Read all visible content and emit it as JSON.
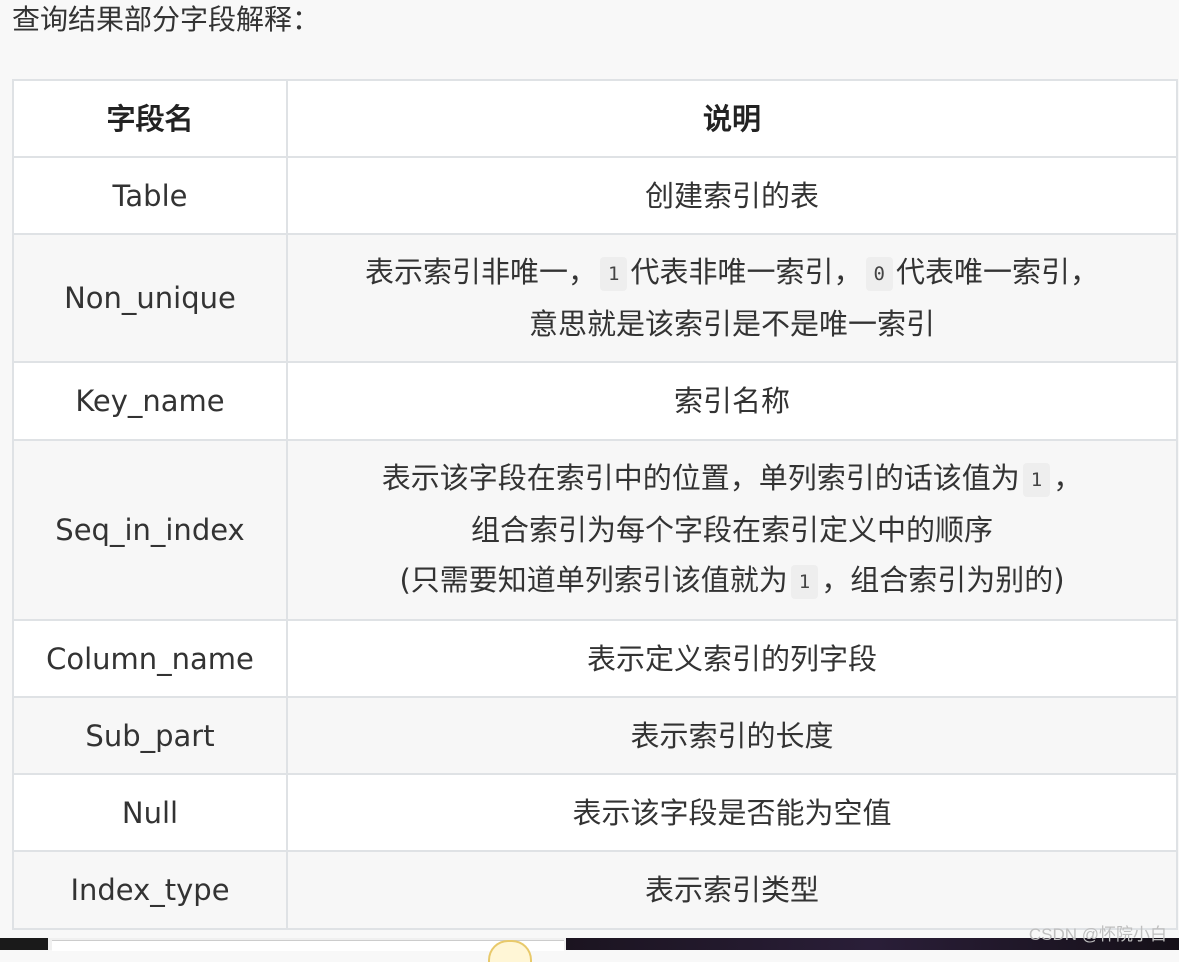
{
  "intro_text": "查询结果部分字段解释：",
  "table": {
    "headers": [
      "字段名",
      "说明"
    ],
    "rows": [
      {
        "field": "Table",
        "desc": "创建索引的表"
      },
      {
        "field": "Non_unique",
        "desc_line1_a": "表示索引非唯一，",
        "code_1": "1",
        "desc_line1_b": "代表非唯一索引，",
        "code_2": "0",
        "desc_line1_c": "代表唯一索引，",
        "desc_line2": "意思就是该索引是不是唯一索引"
      },
      {
        "field": "Key_name",
        "desc": "索引名称"
      },
      {
        "field": "Seq_in_index",
        "desc_line1_a": "表示该字段在索引中的位置，单列索引的话该值为",
        "code_1": "1",
        "desc_line1_b": "，",
        "desc_line2": "组合索引为每个字段在索引定义中的顺序",
        "desc_line3_a": "(只需要知道单列索引该值就为",
        "code_2": "1",
        "desc_line3_b": "，组合索引为别的)"
      },
      {
        "field": "Column_name",
        "desc": "表示定义索引的列字段"
      },
      {
        "field": "Sub_part",
        "desc": "表示索引的长度"
      },
      {
        "field": "Null",
        "desc": "表示该字段是否能为空值"
      },
      {
        "field": "Index_type",
        "desc": "表示索引类型"
      }
    ]
  },
  "watermark": "CSDN @怀院小白"
}
